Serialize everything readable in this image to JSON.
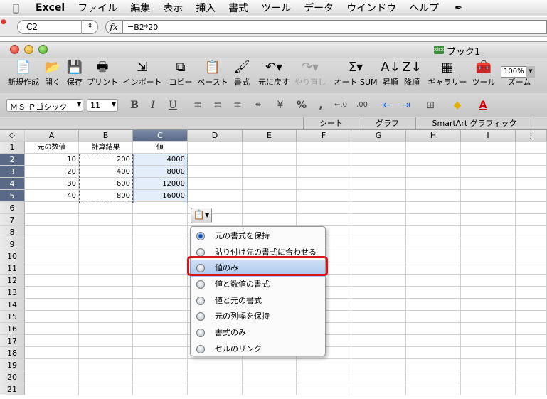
{
  "menubar": {
    "app": "Excel",
    "items": [
      "ファイル",
      "編集",
      "表示",
      "挿入",
      "書式",
      "ツール",
      "データ",
      "ウインドウ",
      "ヘルプ"
    ]
  },
  "formula_bar": {
    "name_box": "C2",
    "fx": "fx",
    "formula": "=B2*20"
  },
  "window": {
    "title": "ブック1",
    "doc_icon": "xlsx"
  },
  "toolbar": {
    "items": [
      {
        "label": "新規作成",
        "icon": "new-icon"
      },
      {
        "label": "開く",
        "icon": "open-icon"
      },
      {
        "label": "保存",
        "icon": "save-icon"
      },
      {
        "label": "プリント",
        "icon": "print-icon"
      },
      {
        "label": "インポート",
        "icon": "import-icon"
      },
      {
        "label": "コピー",
        "icon": "copy-icon"
      },
      {
        "label": "ペースト",
        "icon": "paste-icon"
      },
      {
        "label": "書式",
        "icon": "format-brush-icon"
      },
      {
        "label": "元に戻す",
        "icon": "undo-icon"
      },
      {
        "label": "やり直し",
        "icon": "redo-icon"
      },
      {
        "label": "オート SUM",
        "icon": "sum-icon"
      },
      {
        "label": "昇順",
        "icon": "sort-asc-icon"
      },
      {
        "label": "降順",
        "icon": "sort-desc-icon"
      },
      {
        "label": "ギャラリー",
        "icon": "gallery-icon"
      },
      {
        "label": "ツール",
        "icon": "toolbox-icon"
      },
      {
        "label": "ズーム",
        "icon": "zoom-icon"
      }
    ],
    "zoom_value": "100%"
  },
  "format_bar": {
    "font": "ＭＳ Ｐゴシック",
    "size": "11",
    "bold": "B",
    "italic": "I",
    "underline": "U",
    "percent": "%",
    "comma": ",",
    "font_color_letter": "A"
  },
  "ribbon": {
    "tabs": [
      "シート",
      "グラフ",
      "SmartArt グラフィック"
    ]
  },
  "sheet": {
    "corner": "◇",
    "columns": [
      "A",
      "B",
      "C",
      "D",
      "E",
      "F",
      "G",
      "H",
      "I",
      "J"
    ],
    "selected_column": "C",
    "rows": [
      "1",
      "2",
      "3",
      "4",
      "5",
      "6",
      "7",
      "8",
      "9",
      "10",
      "11",
      "12",
      "13",
      "14",
      "15",
      "16",
      "17",
      "18",
      "19",
      "20",
      "21"
    ],
    "selected_rows": [
      "2",
      "3",
      "4",
      "5"
    ],
    "header_row": [
      "元の数値",
      "計算結果",
      "値"
    ],
    "data": [
      [
        "10",
        "200",
        "4000"
      ],
      [
        "20",
        "400",
        "8000"
      ],
      [
        "30",
        "600",
        "12000"
      ],
      [
        "40",
        "800",
        "16000"
      ]
    ]
  },
  "paste_options": {
    "button_icon": "clipboard-icon",
    "items": [
      {
        "label": "元の書式を保持",
        "selected": true
      },
      {
        "label": "貼り付け先の書式に合わせる",
        "selected": false
      },
      {
        "label": "値のみ",
        "selected": false,
        "highlighted": true
      },
      {
        "label": "値と数値の書式",
        "selected": false
      },
      {
        "label": "値と元の書式",
        "selected": false
      },
      {
        "label": "元の列幅を保持",
        "selected": false
      },
      {
        "label": "書式のみ",
        "selected": false
      },
      {
        "label": "セルのリンク",
        "selected": false
      }
    ],
    "highlight_color": "#d8121a"
  }
}
